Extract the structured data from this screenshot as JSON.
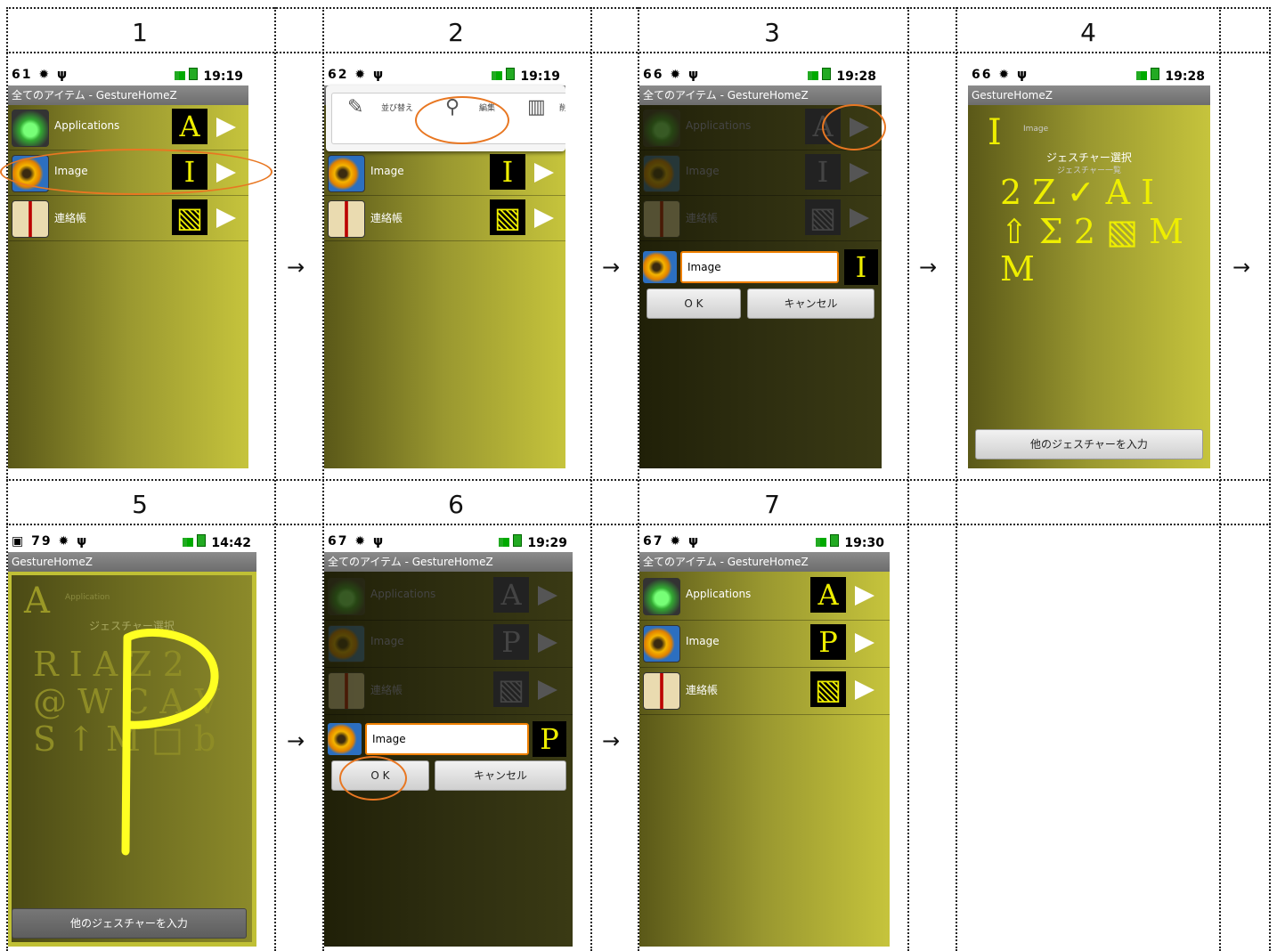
{
  "steps": {
    "s1": "1",
    "s2": "2",
    "s3": "3",
    "s4": "4",
    "s5": "5",
    "s6": "6",
    "s7": "7"
  },
  "arrow": "→",
  "app_title": "全てのアイテム - GestureHomeZ",
  "app_name": "GestureHomeZ",
  "times": {
    "t1": "19:19",
    "t2": "19:19",
    "t3": "19:28",
    "t4": "19:28",
    "t5": "14:42",
    "t6": "19:29",
    "t7": "19:30"
  },
  "calendar_days": {
    "d1": "61",
    "d2": "62",
    "d3": "66",
    "d4": "66",
    "d5": "79",
    "d6": "67",
    "d7": "67"
  },
  "items": {
    "applications": "Applications",
    "image": "Image",
    "contacts": "連絡帳"
  },
  "gestures": {
    "A": "A",
    "I": "I",
    "P": "P",
    "box": "▧"
  },
  "menu": {
    "sort": "並び替え",
    "edit": "編集",
    "delete": "削"
  },
  "edit": {
    "value": "Image",
    "ok": "O K",
    "cancel": "キャンセル"
  },
  "gesture_select": {
    "title": "ジェスチャー選択",
    "subtitle": "ジェスチャー一覧",
    "label_image": "Image",
    "label_application": "Application",
    "other_button": "他のジェスチャーを入力",
    "set4": [
      "2 Z ✓ A I",
      "⇧ Σ 2 ▧ M",
      "M"
    ],
    "set5": [
      "R I A Z 2",
      "@ W C A V",
      "S ↑ M □ b"
    ]
  },
  "icons": [
    "android-icon",
    "sunflower-icon",
    "book-icon",
    "pencil-icon",
    "search-icon",
    "trash-icon",
    "play-icon"
  ]
}
